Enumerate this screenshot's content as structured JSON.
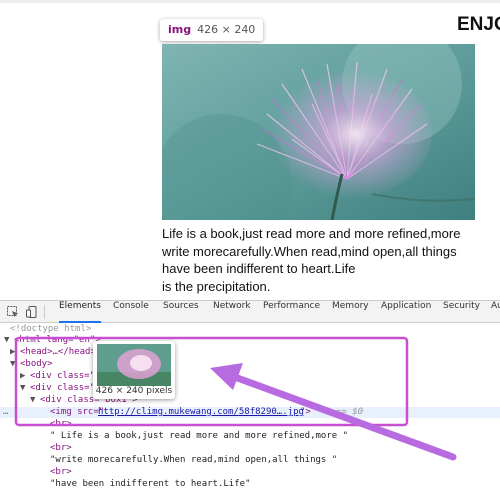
{
  "page": {
    "heading": "ENJO",
    "paragraph_lines": [
      "Life is a book,just read more and more refined,more",
      "write morecarefully.When read,mind open,all things",
      "have been indifferent to heart.Life",
      "is the precipitation."
    ]
  },
  "hover_tooltip": {
    "tag": "img",
    "size": "426 × 240"
  },
  "devtools": {
    "tabs": [
      "Elements",
      "Console",
      "Sources",
      "Network",
      "Performance",
      "Memory",
      "Application",
      "Security",
      "Au"
    ],
    "active_tab": "Elements",
    "icons": [
      "inspect-icon",
      "device-toggle-icon"
    ],
    "dom_lines": {
      "doctype": "<!doctype html>",
      "html_open": "<html lang=\"en\">",
      "head": "<head>…</head>",
      "body": "<body>",
      "div1": "<div class=\"",
      "div2": "<div class=\"",
      "div_box": "<div class=\"box1\">",
      "img_prefix": "<img src=\"",
      "img_url": "http://climg.mukewang.com/58f8290….jpg",
      "img_suffix": "\">",
      "selected_marker": "== $0",
      "br1": "<br>",
      "text1": "\" Life is a book,just read more and more refined,more \"",
      "br2": "<br>",
      "text2": "\"write morecarefully.When read,mind open,all things \"",
      "br3": "<br>",
      "text3": "\"have been indifferent to heart.Life\""
    },
    "gutter_dots": "…",
    "image_preview": {
      "caption": "426 × 240 pixels"
    }
  },
  "annotation": {
    "box_color": "#c94fd1",
    "arrow_color": "#b86be0"
  },
  "colors": {
    "tag": "#881280",
    "attr": "#994500",
    "value": "#1a1aa6",
    "accent": "#1a73e8",
    "selected_row": "#e8f0fe"
  }
}
